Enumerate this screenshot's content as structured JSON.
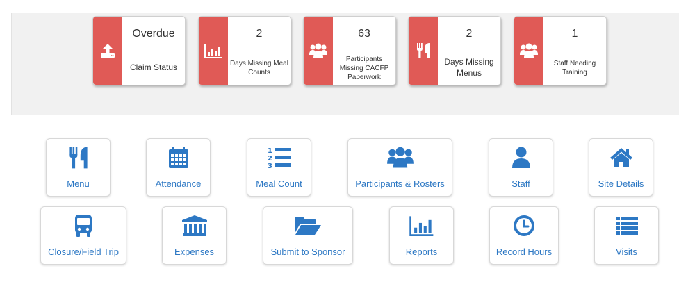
{
  "colors": {
    "accent_red": "#e05a56",
    "link_blue": "#2d78c4"
  },
  "status_cards": [
    {
      "icon": "upload-icon",
      "value": "Overdue",
      "label": "Claim Status"
    },
    {
      "icon": "bar-chart-icon",
      "value": "2",
      "label": "Days Missing Meal Counts"
    },
    {
      "icon": "users-icon",
      "value": "63",
      "label": "Participants Missing CACFP Paperwork"
    },
    {
      "icon": "utensils-icon",
      "value": "2",
      "label": "Days Missing Menus"
    },
    {
      "icon": "users-icon",
      "value": "1",
      "label": "Staff Needing Training"
    }
  ],
  "nav_tiles": [
    {
      "icon": "utensils-icon",
      "label": "Menu"
    },
    {
      "icon": "calendar-icon",
      "label": "Attendance"
    },
    {
      "icon": "numbered-list-icon",
      "label": "Meal Count"
    },
    {
      "icon": "users-icon",
      "label": "Participants & Rosters"
    },
    {
      "icon": "user-icon",
      "label": "Staff"
    },
    {
      "icon": "home-icon",
      "label": "Site Details"
    },
    {
      "icon": "bus-icon",
      "label": "Closure/Field Trip"
    },
    {
      "icon": "bank-icon",
      "label": "Expenses"
    },
    {
      "icon": "folder-open-icon",
      "label": "Submit to Sponsor"
    },
    {
      "icon": "bar-chart-icon",
      "label": "Reports"
    },
    {
      "icon": "clock-icon",
      "label": "Record Hours"
    },
    {
      "icon": "list-icon",
      "label": "Visits"
    }
  ]
}
